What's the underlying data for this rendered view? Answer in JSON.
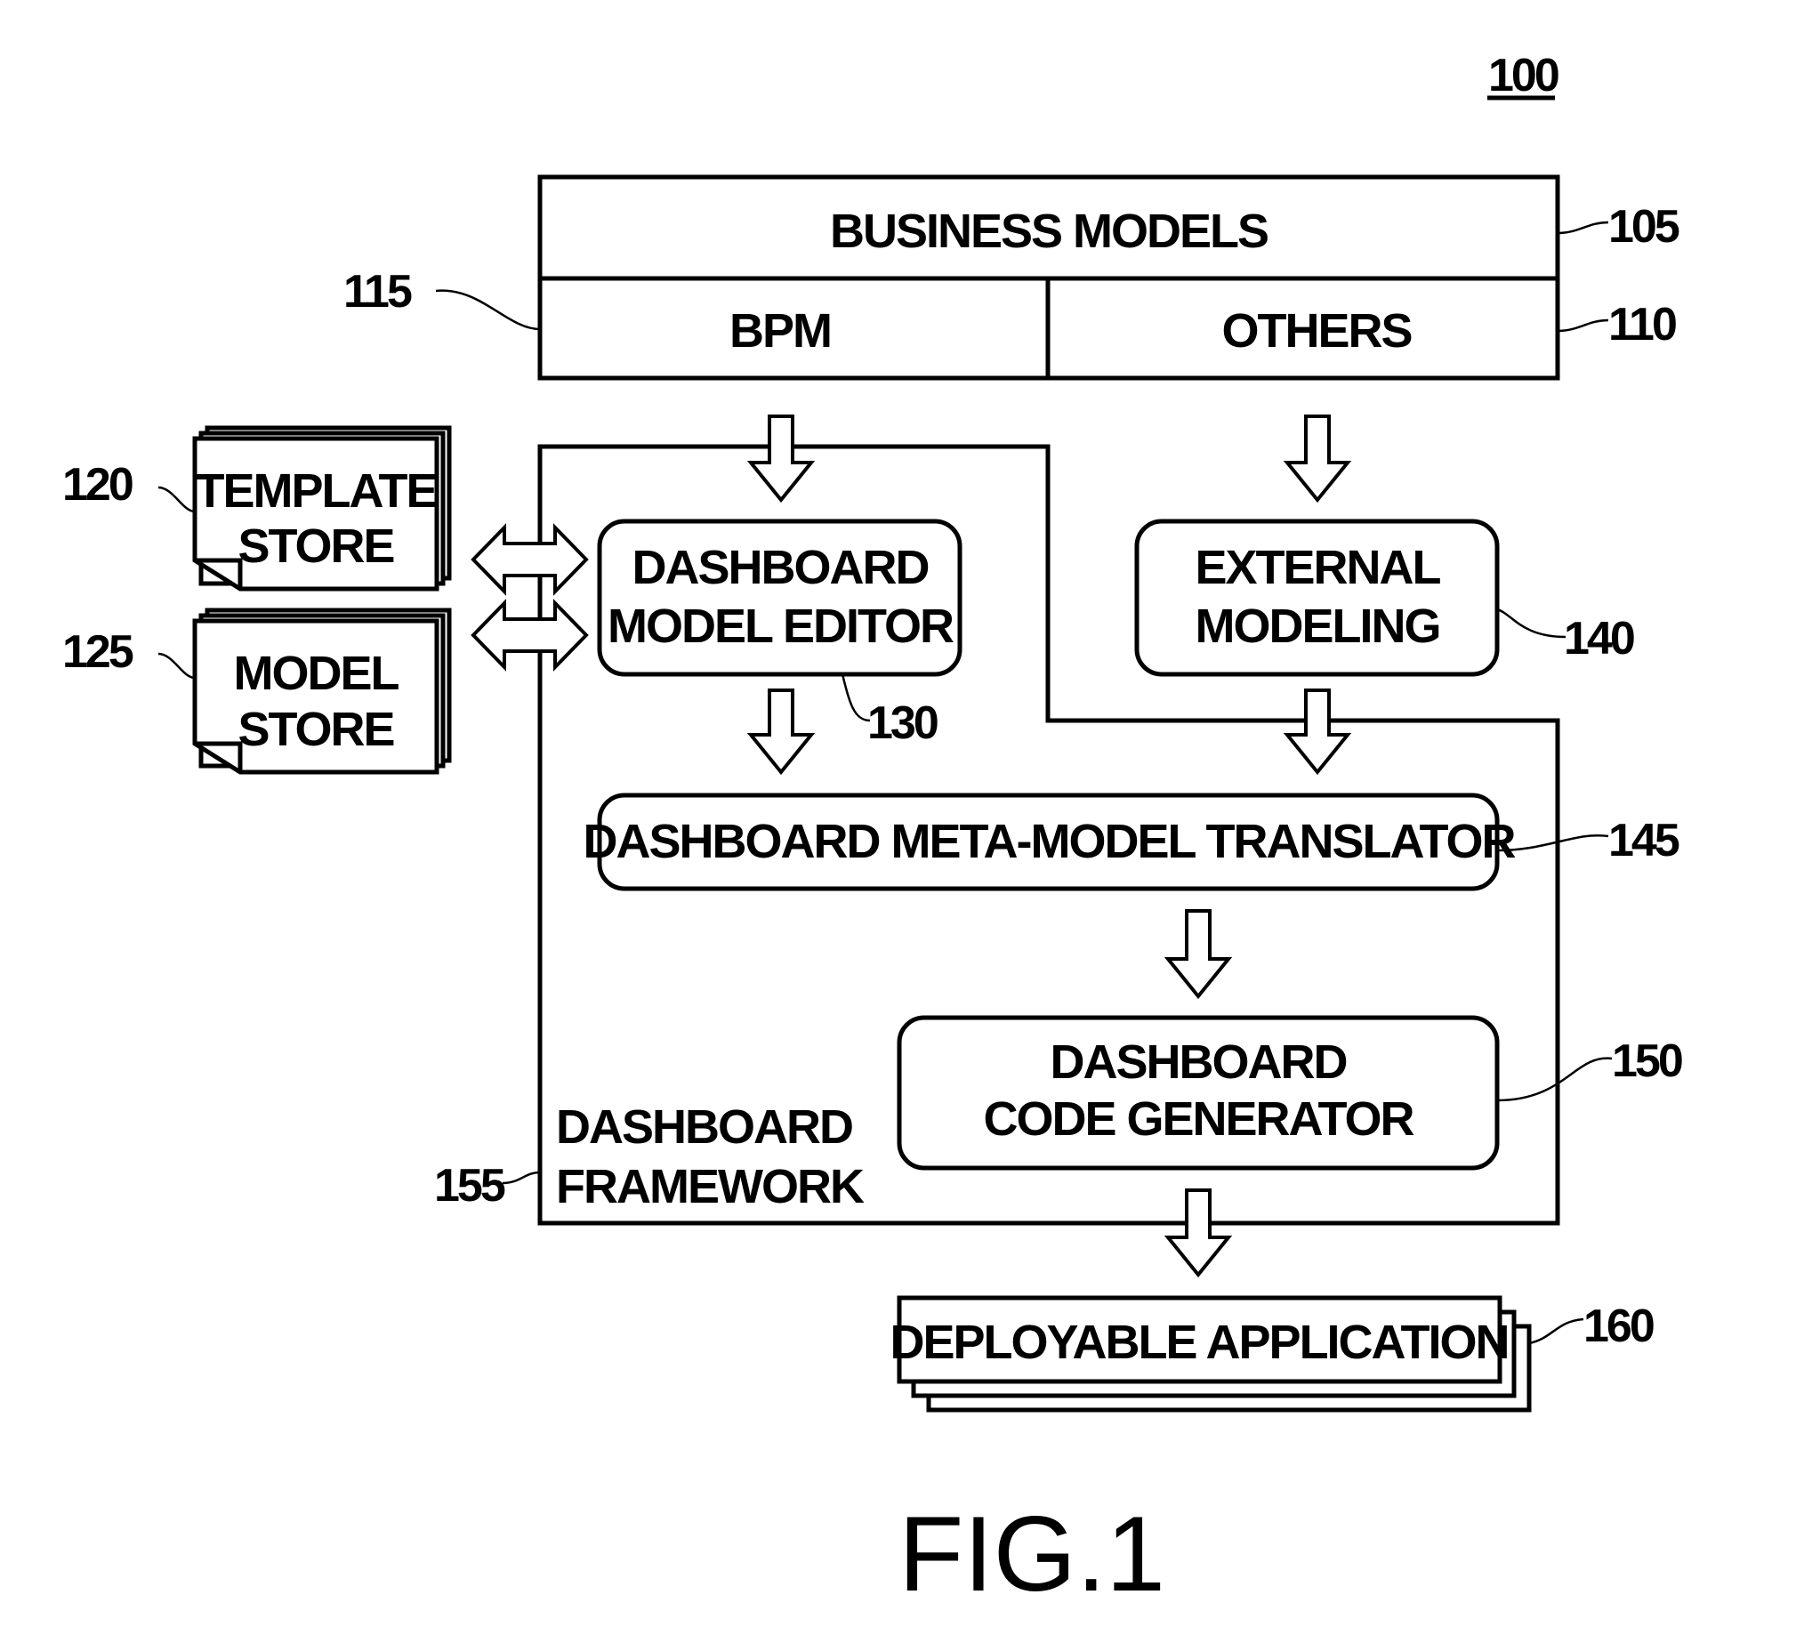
{
  "figure": {
    "caption": "FIG.1",
    "ref_number": "100"
  },
  "business_models": {
    "title": "BUSINESS MODELS",
    "title_ref": "105",
    "bpm_label": "BPM",
    "bpm_ref": "115",
    "others_label": "OTHERS",
    "others_ref": "110"
  },
  "stores": {
    "template": {
      "line1": "TEMPLATE",
      "line2": "STORE",
      "ref": "120"
    },
    "model": {
      "line1": "MODEL",
      "line2": "STORE",
      "ref": "125"
    }
  },
  "framework": {
    "line1": "DASHBOARD",
    "line2": "FRAMEWORK",
    "ref": "155"
  },
  "model_editor": {
    "line1": "DASHBOARD",
    "line2": "MODEL EDITOR",
    "ref": "130"
  },
  "external_modeling": {
    "line1": "EXTERNAL",
    "line2": "MODELING",
    "ref": "140"
  },
  "translator": {
    "label": "DASHBOARD META-MODEL TRANSLATOR",
    "ref": "145"
  },
  "code_generator": {
    "line1": "DASHBOARD",
    "line2": "CODE GENERATOR",
    "ref": "150"
  },
  "deployable": {
    "label": "DEPLOYABLE APPLICATION",
    "ref": "160"
  },
  "colors": {
    "ink": "#000000",
    "paper": "#ffffff"
  }
}
